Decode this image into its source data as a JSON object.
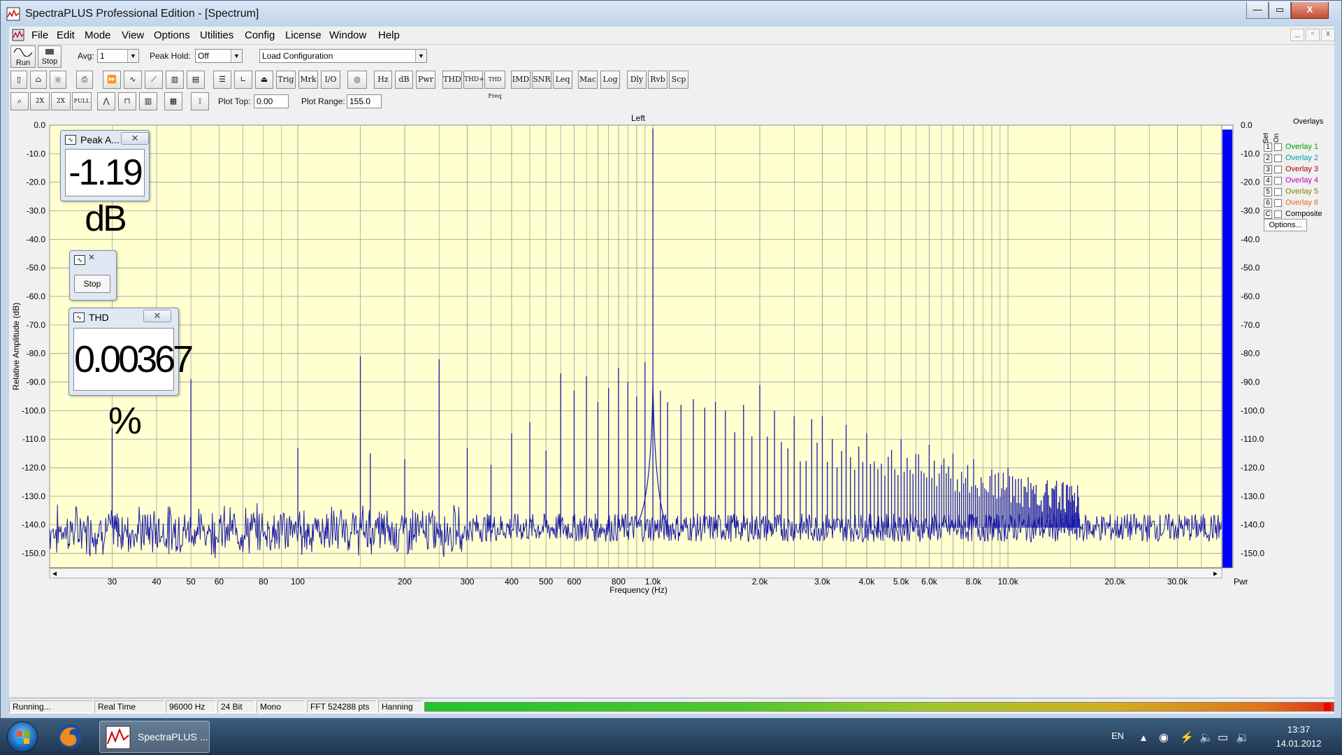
{
  "window": {
    "title": "SpectraPLUS Professional Edition - [Spectrum]",
    "min_label": "—",
    "max_label": "▭",
    "close_label": "X"
  },
  "menu": {
    "items": [
      "File",
      "Edit",
      "Mode",
      "View",
      "Options",
      "Utilities",
      "Config",
      "License",
      "Window",
      "Help"
    ],
    "mdi_min": "_",
    "mdi_restore": "▫",
    "mdi_close": "x"
  },
  "toolbar": {
    "run_label": "Run",
    "stop_label": "Stop",
    "avg_label": "Avg:",
    "avg_value": "1",
    "peak_hold_label": "Peak Hold:",
    "peak_hold_value": "Off",
    "load_config_value": "Load Configuration",
    "row2_buttons": [
      "Trig",
      "Mrk",
      "I/O",
      "Hz",
      "dB",
      "Pwr",
      "THD",
      "THD+N",
      "THD Freq",
      "IMD",
      "SNR",
      "Leq",
      "Mac",
      "Log",
      "Dly",
      "Rvb",
      "Scp"
    ],
    "row3_buttons": [
      "2X",
      "2X",
      "FULL"
    ],
    "plot_top_label": "Plot Top:",
    "plot_top_value": "0.00",
    "plot_range_label": "Plot Range:",
    "plot_range_value": "155.0"
  },
  "plot": {
    "channel": "Left",
    "xlabel": "Frequency (Hz)",
    "ylabel": "Relative Amplitude (dB)",
    "right_axis_label": "Pwr",
    "colors": {
      "background": "#ffffd0",
      "trace": "#1a1aa8",
      "grid": "#9a9a9a",
      "power_bar": "#0000ff"
    }
  },
  "chart_data": {
    "type": "line",
    "title": "Left",
    "xlabel": "Frequency (Hz)",
    "ylabel": "Relative Amplitude (dB)",
    "x_scale": "log",
    "xlim": [
      20,
      40000
    ],
    "ylim": [
      -155,
      0
    ],
    "x_tick_labels": [
      "30",
      "40",
      "50",
      "60",
      "80",
      "100",
      "200",
      "300",
      "400",
      "500",
      "600",
      "800",
      "1.0k",
      "2.0k",
      "3.0k",
      "4.0k",
      "5.0k",
      "6.0k",
      "8.0k",
      "10.0k",
      "20.0k",
      "30.0k"
    ],
    "x_ticks": [
      30,
      40,
      50,
      60,
      80,
      100,
      200,
      300,
      400,
      500,
      600,
      800,
      1000,
      2000,
      3000,
      4000,
      5000,
      6000,
      8000,
      10000,
      20000,
      30000
    ],
    "y_ticks": [
      0,
      -10,
      -20,
      -30,
      -40,
      -50,
      -60,
      -70,
      -80,
      -90,
      -100,
      -110,
      -120,
      -130,
      -140,
      -150
    ],
    "y_tick_labels": [
      "0.0",
      "-10.0",
      "-20.0",
      "-30.0",
      "-40.0",
      "-50.0",
      "-60.0",
      "-70.0",
      "-80.0",
      "-90.0",
      "-100.0",
      "-110.0",
      "-120.0",
      "-130.0",
      "-140.0",
      "-150.0"
    ],
    "grid": true,
    "noise_floor_db": -141,
    "peaks": [
      {
        "x": 30,
        "y": -106
      },
      {
        "x": 50,
        "y": -89
      },
      {
        "x": 100,
        "y": -113
      },
      {
        "x": 150,
        "y": -81
      },
      {
        "x": 160,
        "y": -115
      },
      {
        "x": 200,
        "y": -117
      },
      {
        "x": 250,
        "y": -82
      },
      {
        "x": 300,
        "y": -113
      },
      {
        "x": 350,
        "y": -119
      },
      {
        "x": 400,
        "y": -108
      },
      {
        "x": 450,
        "y": -104
      },
      {
        "x": 500,
        "y": -114
      },
      {
        "x": 550,
        "y": -87
      },
      {
        "x": 600,
        "y": -93
      },
      {
        "x": 650,
        "y": -88
      },
      {
        "x": 700,
        "y": -97
      },
      {
        "x": 750,
        "y": -92
      },
      {
        "x": 800,
        "y": -85
      },
      {
        "x": 850,
        "y": -90
      },
      {
        "x": 900,
        "y": -95
      },
      {
        "x": 950,
        "y": -83
      },
      {
        "x": 1000,
        "y": -1.19
      },
      {
        "x": 1050,
        "y": -93
      },
      {
        "x": 1100,
        "y": -97
      },
      {
        "x": 1200,
        "y": -98
      },
      {
        "x": 1300,
        "y": -96
      },
      {
        "x": 1400,
        "y": -99
      },
      {
        "x": 1500,
        "y": -97
      },
      {
        "x": 1600,
        "y": -100
      },
      {
        "x": 1800,
        "y": -98
      },
      {
        "x": 2000,
        "y": -91
      },
      {
        "x": 2200,
        "y": -100
      },
      {
        "x": 2500,
        "y": -102
      },
      {
        "x": 2800,
        "y": -103
      },
      {
        "x": 3000,
        "y": -102
      },
      {
        "x": 3500,
        "y": -105
      },
      {
        "x": 4000,
        "y": -108
      },
      {
        "x": 5000,
        "y": -110
      },
      {
        "x": 6000,
        "y": -112
      },
      {
        "x": 7000,
        "y": -115
      },
      {
        "x": 8000,
        "y": -117
      },
      {
        "x": 10000,
        "y": -120
      },
      {
        "x": 12000,
        "y": -126
      },
      {
        "x": 15000,
        "y": -132
      }
    ]
  },
  "overlays": {
    "title": "Overlays",
    "set_label": "Set",
    "on_label": "On",
    "items": [
      {
        "num": "1",
        "name": "Overlay 1",
        "color": "#00a000"
      },
      {
        "num": "2",
        "name": "Overlay 2",
        "color": "#00a0a0"
      },
      {
        "num": "3",
        "name": "Overlay 3",
        "color": "#a00000"
      },
      {
        "num": "4",
        "name": "Overlay 4",
        "color": "#c000c0"
      },
      {
        "num": "5",
        "name": "Overlay 5",
        "color": "#808000"
      },
      {
        "num": "6",
        "name": "Overlay 6",
        "color": "#e07020"
      },
      {
        "num": "C",
        "name": "Composite",
        "color": "#000000"
      }
    ],
    "options_label": "Options..."
  },
  "readouts": {
    "peak": {
      "title": "Peak A...",
      "value": "-1.19 dB"
    },
    "stop": {
      "label": "Stop"
    },
    "thd": {
      "title": "THD",
      "value": "0.00367 %"
    }
  },
  "power_bar": {
    "fill_fraction": 0.99
  },
  "status": {
    "state": "Running...",
    "mode": "Real Time",
    "rate": "96000 Hz",
    "bits": "24 Bit",
    "channels": "Mono",
    "fft": "FFT 524288 pts",
    "window": "Hanning"
  },
  "taskbar": {
    "app_label": "SpectraPLUS ...",
    "lang": "EN",
    "time": "13:37",
    "date": "14.01.2012"
  }
}
